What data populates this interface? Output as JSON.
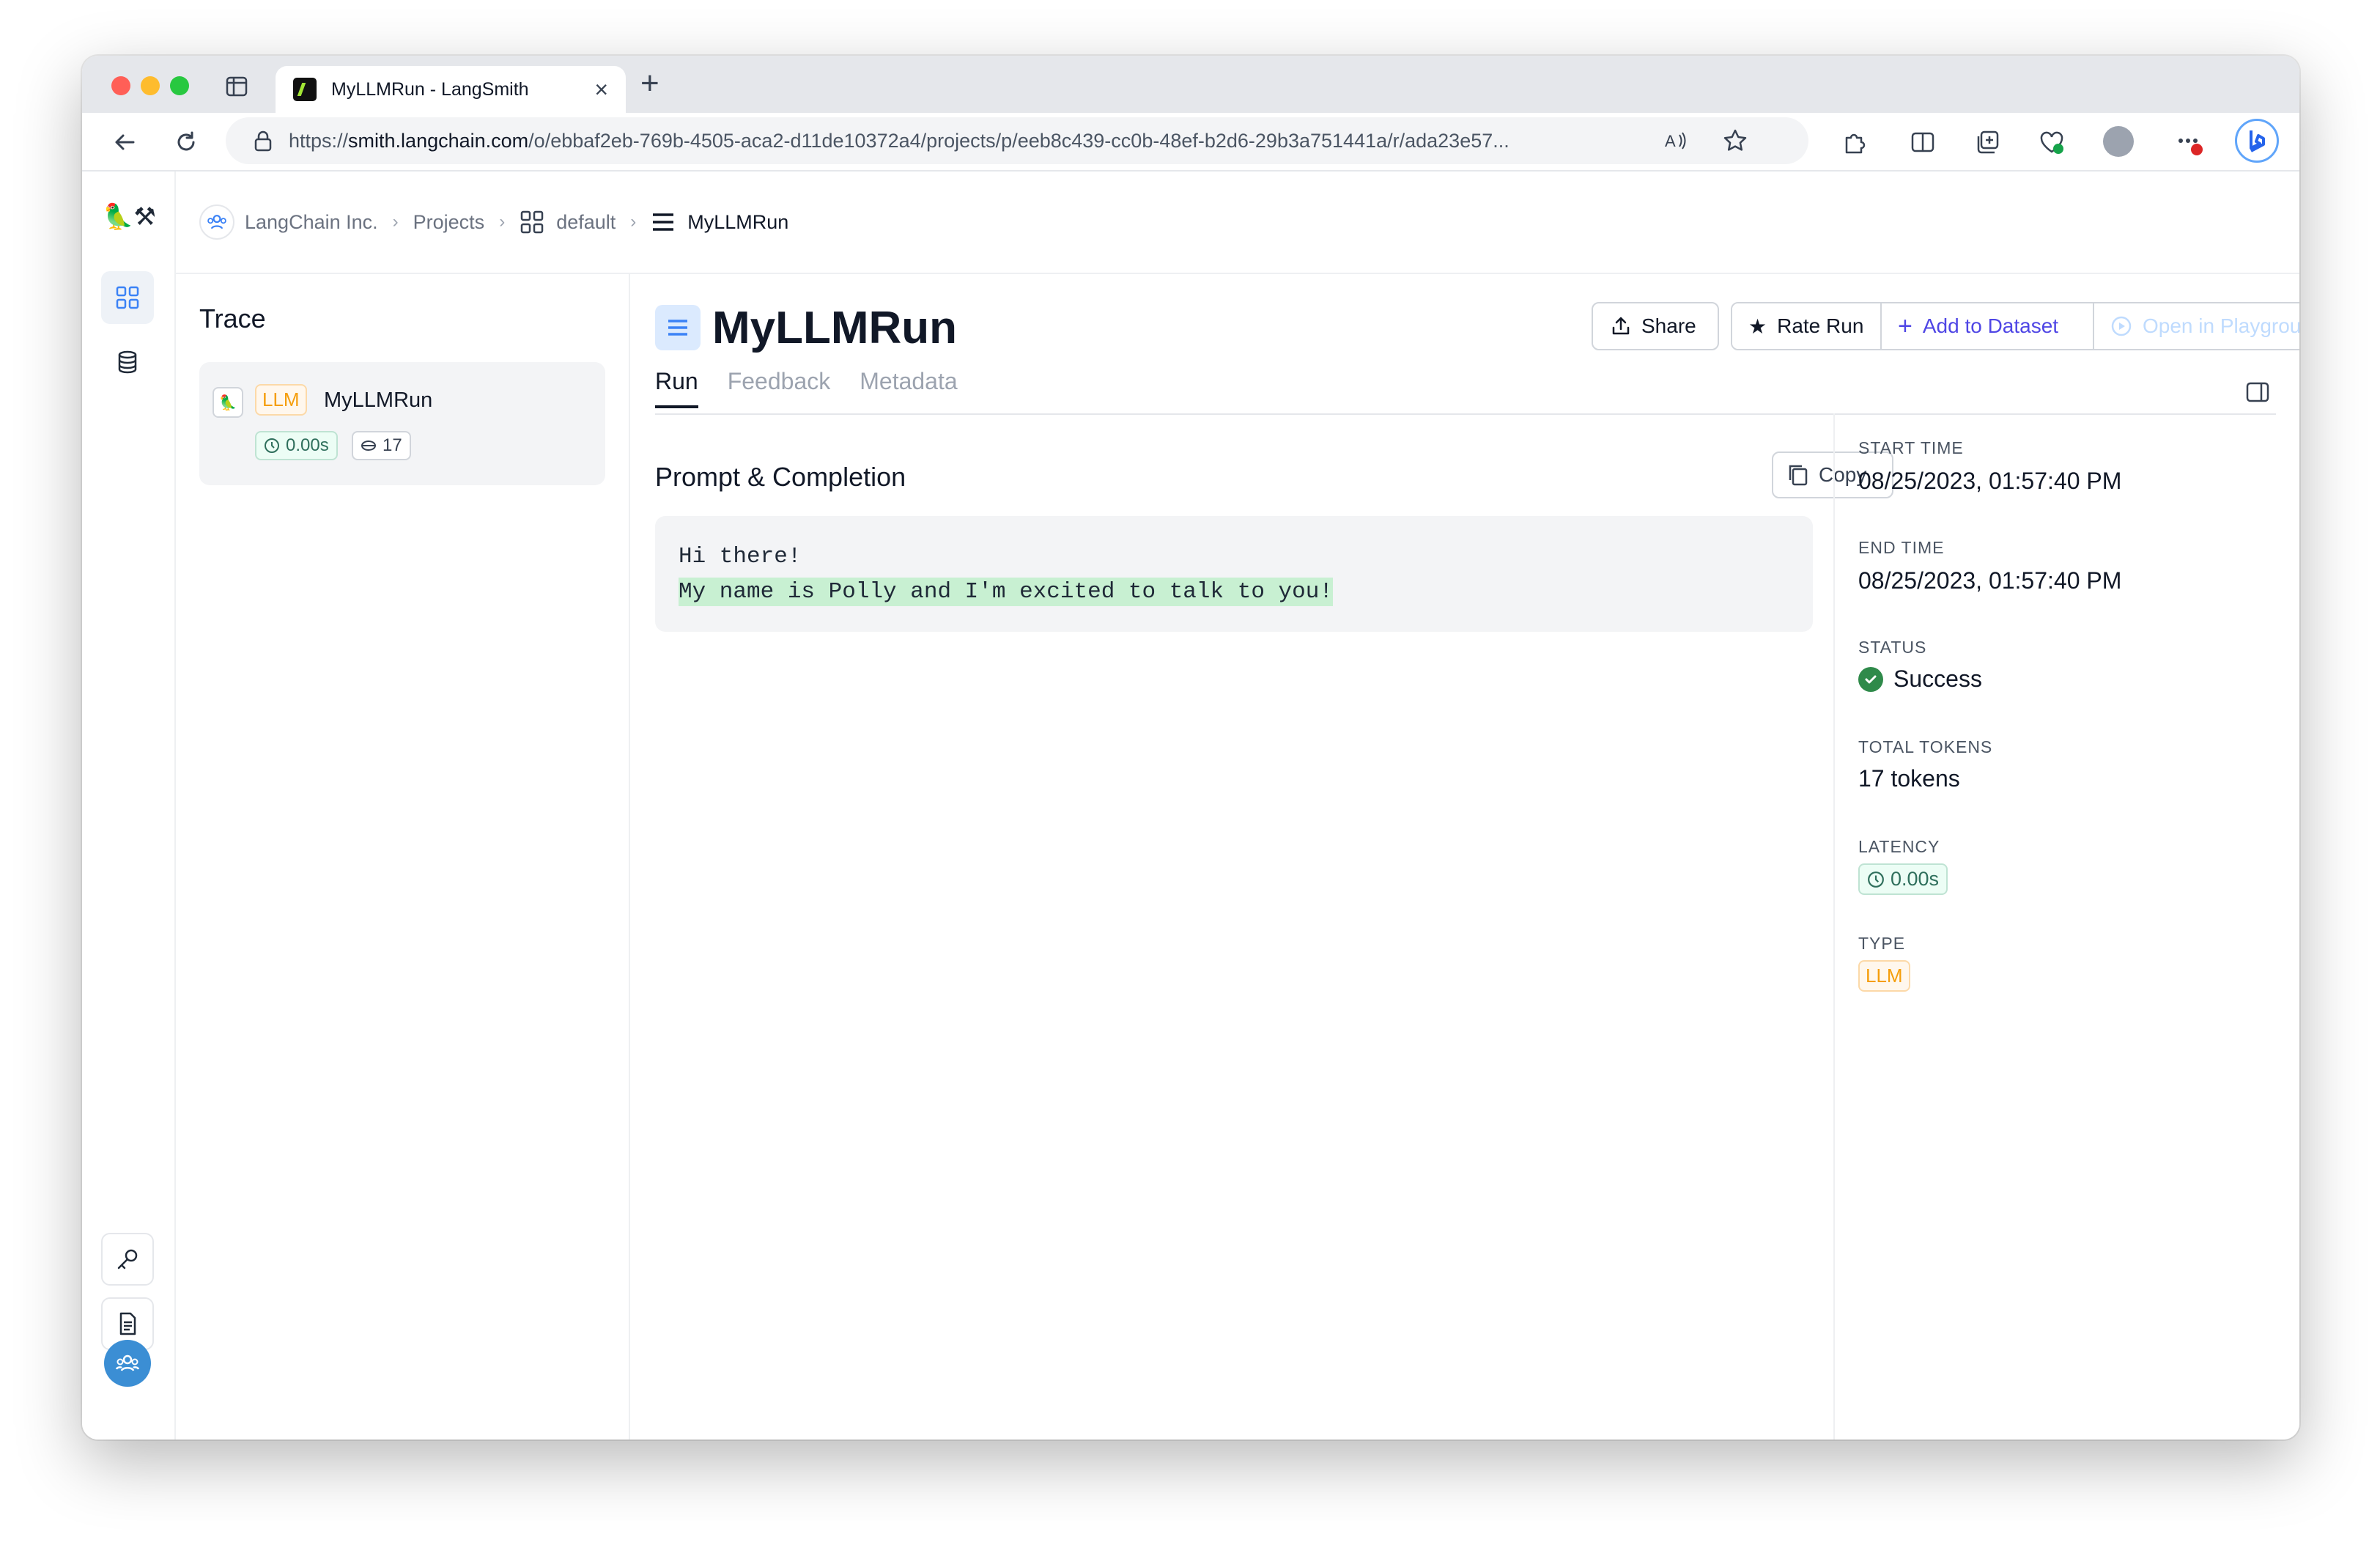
{
  "browser": {
    "tab_title": "MyLLMRun - LangSmith",
    "url_prefix": "https://",
    "url_domain": "smith.langchain.com",
    "url_path": "/o/ebbaf2eb-769b-4505-aca2-d11de10372a4/projects/p/eeb8c439-cc0b-48ef-b2d6-29b3a751441a/r/ada23e57..."
  },
  "breadcrumb": {
    "org": "LangChain Inc.",
    "projects": "Projects",
    "project": "default",
    "current": "MyLLMRun"
  },
  "trace": {
    "title": "Trace",
    "item": {
      "type": "LLM",
      "name": "MyLLMRun",
      "latency": "0.00s",
      "tokens": "17"
    }
  },
  "run": {
    "title": "MyLLMRun",
    "buttons": {
      "share": "Share",
      "rate": "Rate Run",
      "add_dataset": "Add to Dataset",
      "playground": "Open in Playground"
    },
    "tabs": [
      "Run",
      "Feedback",
      "Metadata"
    ],
    "active_tab": "Run",
    "section_title": "Prompt & Completion",
    "copy_label": "Copy",
    "prompt": "Hi there!",
    "completion": "My name is Polly and I'm excited to talk to you!"
  },
  "details": {
    "start_time_label": "START TIME",
    "start_time": "08/25/2023, 01:57:40 PM",
    "end_time_label": "END TIME",
    "end_time": "08/25/2023, 01:57:40 PM",
    "status_label": "STATUS",
    "status": "Success",
    "total_tokens_label": "TOTAL TOKENS",
    "total_tokens": "17 tokens",
    "latency_label": "LATENCY",
    "latency": "0.00s",
    "type_label": "TYPE",
    "type": "LLM"
  },
  "colors": {
    "llm_accent": "#f59e0b",
    "success": "#2f8a4a",
    "add_dataset": "#4f46e5",
    "completion_highlight": "#c8f0d2"
  }
}
